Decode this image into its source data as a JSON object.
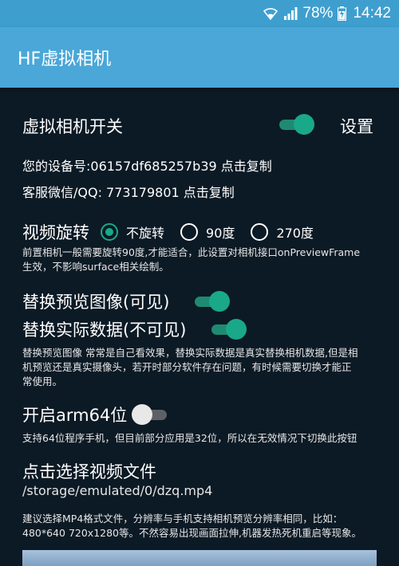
{
  "status_bar": {
    "battery": "78%",
    "time": "14:42"
  },
  "app_bar": {
    "title": "HF虚拟相机"
  },
  "virtual_camera": {
    "label": "虚拟相机开关",
    "enabled": true,
    "settings_label": "设置"
  },
  "device_id": {
    "text": "您的设备号:06157df685257b39 点击复制"
  },
  "support": {
    "text": "客服微信/QQ: 773179801 点击复制"
  },
  "rotation": {
    "label": "视频旋转",
    "options": [
      {
        "label": "不旋转",
        "selected": true
      },
      {
        "label": "90度",
        "selected": false
      },
      {
        "label": "270度",
        "selected": false
      }
    ],
    "hint_line1": "前置相机一般需要旋转90度,才能适合，此设置对相机接口onPreviewFrame",
    "hint_line2": "生效，不影响surface相关绘制。"
  },
  "replace_preview": {
    "label": "替换预览图像(可见)",
    "enabled": true
  },
  "replace_data": {
    "label": "替换实际数据(不可见)",
    "enabled": true,
    "hint_line1": "替换预览图像 常常是自己看效果，替换实际数据是真实替换相机数据,但是相",
    "hint_line2": "机预览还是真实摄像头，若开时部分软件存在问题，有时候需要切换才能正",
    "hint_line3": "常使用。"
  },
  "arm64": {
    "label": "开启arm64位",
    "enabled": false,
    "hint": "支持64位程序手机，但目前部分应用是32位，所以在无效情况下切换此按钮"
  },
  "video_file": {
    "label": "点击选择视频文件",
    "path": "/storage/emulated/0/dzq.mp4",
    "hint_line1": "建议选择MP4格式文件，分辨率与手机支持相机预览分辨率相同，比如：",
    "hint_line2": "480*640 720x1280等。不然容易出现画面拉伸,机器发热死机重启等现象。"
  },
  "colors": {
    "background": "#0c1a25",
    "app_bar": "#4aa7d8",
    "accent": "#1aa88a"
  }
}
